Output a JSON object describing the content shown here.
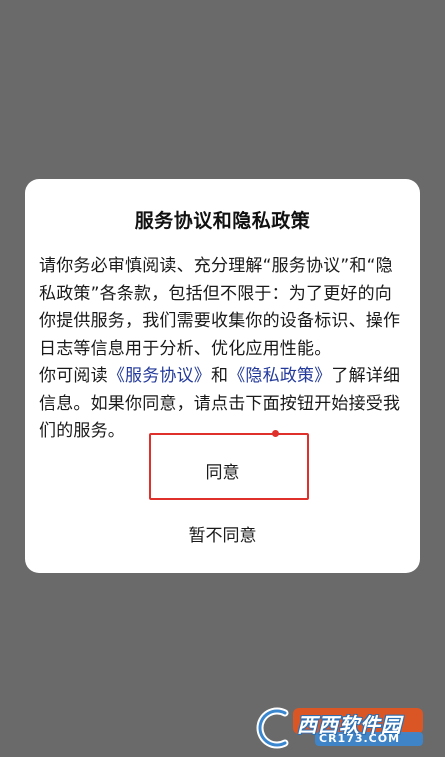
{
  "dialog": {
    "title": "服务协议和隐私政策",
    "paragraph1": "请你务必审慎阅读、充分理解“服务协议”和“隐私政策”各条款，包括但不限于：为了更好的向你提供服务，我们需要收集你的设备标识、操作日志等信息用于分析、优化应用性能。",
    "paragraph2": {
      "prefix": "你可阅读",
      "link_service": "《服务协议》",
      "and": "和",
      "link_privacy": "《隐私政策》",
      "suffix": "了解详细信息。如果你同意，请点击下面按钮开始接受我们的服务。"
    },
    "agree_label": "同意",
    "disagree_label": "暂不同意"
  },
  "watermark": {
    "brand": "西西软件园",
    "site": "CR173.COM"
  },
  "colors": {
    "overlay": "#6a6a6a",
    "link": "#233a9a",
    "highlight": "#e0302c"
  }
}
